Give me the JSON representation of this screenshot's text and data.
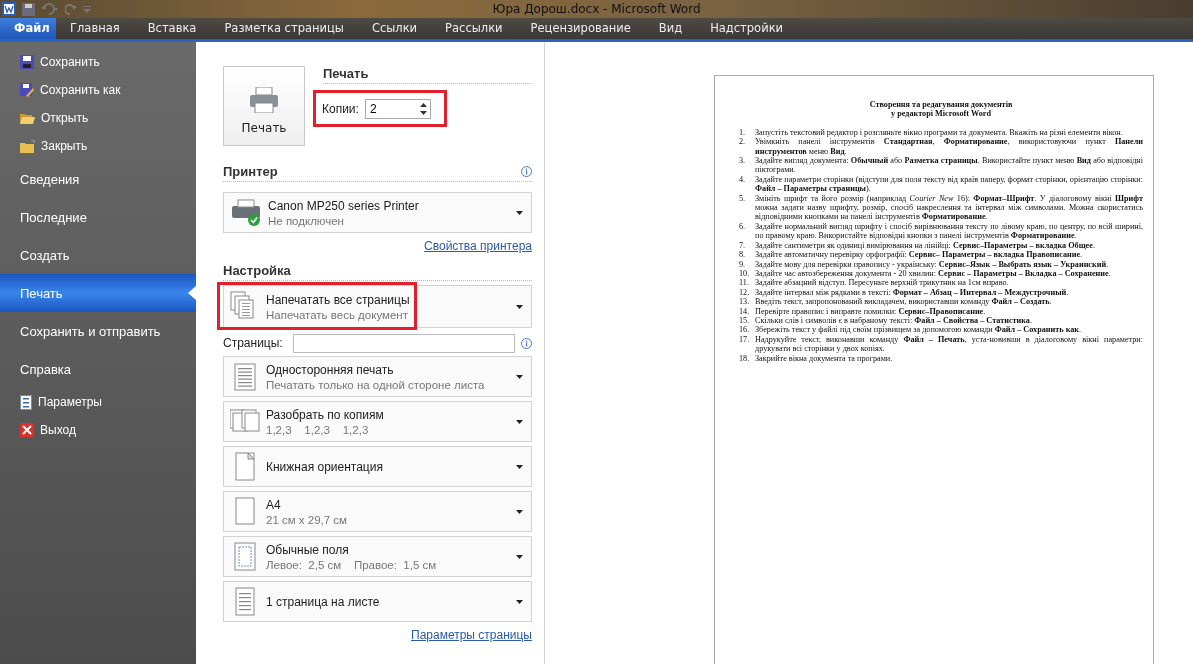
{
  "window": {
    "title": "Юра Дорош.docx - Microsoft Word"
  },
  "ribbon_tabs": [
    {
      "label": "Файл",
      "selected": true
    },
    {
      "label": "Главная",
      "selected": false
    },
    {
      "label": "Вставка",
      "selected": false
    },
    {
      "label": "Разметка страницы",
      "selected": false
    },
    {
      "label": "Ссылки",
      "selected": false
    },
    {
      "label": "Рассылки",
      "selected": false
    },
    {
      "label": "Рецензирование",
      "selected": false
    },
    {
      "label": "Вид",
      "selected": false
    },
    {
      "label": "Надстройки",
      "selected": false
    }
  ],
  "sidebar": {
    "items": [
      {
        "kind": "command",
        "label": "Сохранить",
        "selected": false
      },
      {
        "kind": "command",
        "label": "Сохранить как",
        "selected": false
      },
      {
        "kind": "command",
        "label": "Открыть",
        "selected": false
      },
      {
        "kind": "command",
        "label": "Закрыть",
        "selected": false
      },
      {
        "kind": "section",
        "label": "Сведения",
        "selected": false
      },
      {
        "kind": "section",
        "label": "Последние",
        "selected": false
      },
      {
        "kind": "section",
        "label": "Создать",
        "selected": false
      },
      {
        "kind": "section",
        "label": "Печать",
        "selected": true
      },
      {
        "kind": "section",
        "label": "Сохранить и отправить",
        "selected": false
      },
      {
        "kind": "section",
        "label": "Справка",
        "selected": false
      },
      {
        "kind": "command",
        "label": "Параметры",
        "selected": false
      },
      {
        "kind": "command",
        "label": "Выход",
        "selected": false
      }
    ]
  },
  "print": {
    "button": "Печать",
    "heading": "Печать",
    "copies": {
      "label": "Копии:",
      "value": "2",
      "highlighted": true
    }
  },
  "printer": {
    "heading": "Принтер",
    "name": "Canon MP250 series Printer",
    "status": "Не подключен",
    "link": "Свойства принтера"
  },
  "settings": {
    "heading": "Настройка",
    "items": [
      {
        "kind": "dropdown",
        "title": "Напечатать все страницы",
        "subtitle": "Напечатать весь документ",
        "highlighted": true
      },
      {
        "kind": "field",
        "label": "Страницы:"
      },
      {
        "kind": "dropdown",
        "title": "Односторонняя печать",
        "subtitle": "Печатать только на одной стороне листа",
        "highlighted": false
      },
      {
        "kind": "dropdown",
        "title": "Разобрать по копиям",
        "subtitle": "1,2,3    1,2,3    1,2,3",
        "highlighted": false
      },
      {
        "kind": "dropdown",
        "title": "Книжная ориентация",
        "highlighted": false
      },
      {
        "kind": "dropdown",
        "title": "A4",
        "subtitle": "21 см x 29,7 см",
        "highlighted": false
      },
      {
        "kind": "dropdown",
        "title": "Обычные поля",
        "subtitle": "Левое:  2,5 см    Правое:  1,5 см",
        "highlighted": false
      },
      {
        "kind": "dropdown",
        "title": "1 страница на листе",
        "highlighted": false
      }
    ],
    "link": "Параметры страницы"
  },
  "preview": {
    "title": [
      "Створення та редагування документів",
      "у редакторі Microsoft Word"
    ],
    "items": [
      {
        "number": "1.",
        "text": "Запустіть текстовий редактор і розгляньте вікно програми та документа. Вкажіть на різні елементи вікон."
      },
      {
        "number": "2.",
        "text": "Увімкніть панелі інструментів **Стандартная**, **Форматирование**, використовуючи пункт **Панели инструментов** меню **Вид**."
      },
      {
        "number": "3.",
        "text": "Задайте вигляд документа: **Обычный** або **Разметка страницы**. Використайте пункт меню **Вид** або відповідні піктограми."
      },
      {
        "number": "4.",
        "text": "Задайте параметри сторінки (відступи для поля тексту від країв паперу, формат сторінки, орієнтацію сторінки: **Файл – Параметры страницы**)."
      },
      {
        "number": "5.",
        "text": "Змініть шрифт та його розмір (наприклад *Courier New* 16): **Формат–Шрифт**. У діалоговому вікні **Шрифт** можна задати назву шрифту, розмір, спосіб накреслення та інтервал між символами. Можна скористатись відповідними кнопками на панелі інструментів **Форматирование**."
      },
      {
        "number": "6.",
        "text": "Задайте нормальний вигляд шрифту і спосіб вирівнювання тексту по лівому краю, по центру, по всій ширині, по правому краю. Використайте відповідні кнопки з панелі інструментів **Форматирование**."
      },
      {
        "number": "7.",
        "text": "Задайте сантиметри як одиниці вимірювання на лінійці: **Сервис–Параметры – вкладка Общее**."
      },
      {
        "number": "8.",
        "text": "Задайте автоматичну перевірку орфографії: **Сервис– Параметры – вкладка Правописание**."
      },
      {
        "number": "9.",
        "text": "Задайте мову для перевірки правопису - українську: **Сервис–Язык – Выбрать язык – Украинский**."
      },
      {
        "number": "10.",
        "text": "Задайте час автозбереження документа - 20 хвилин: **Сервис – Параметры – Вкладка – Сохранение**."
      },
      {
        "number": "11.",
        "text": "Задайте абзацний відступ. Пересуньте верхній трикутник на 1см вправо."
      },
      {
        "number": "12.",
        "text": "Задайте інтервал між рядками в тексті: **Формат – Абзац – Интервал – Междустрочный**."
      },
      {
        "number": "13.",
        "text": "Введіть текст, запропонований викладачем, використавши команду **Файл – Создать**."
      },
      {
        "number": "14.",
        "text": "Перевірте правопис і виправте помилки: **Сервис–Правописание**."
      },
      {
        "number": "15.",
        "text": "Скільки слів і символів є в набраному тексті: **Файл – Свойства – Статистика**."
      },
      {
        "number": "16.",
        "text": "Збережіть текст у файлі під своїм прізвищем за допомогою команди **Файл – Сохранить как**."
      },
      {
        "number": "17.",
        "text": "Надрукуйте текст, виконавши команду **Файл – Печать**, уста-новивши в діалоговому вікні параметри: друкувати всі сторінки у двох копіях."
      },
      {
        "number": "18.",
        "text": "Закрийте вікна документа та програми."
      }
    ]
  }
}
